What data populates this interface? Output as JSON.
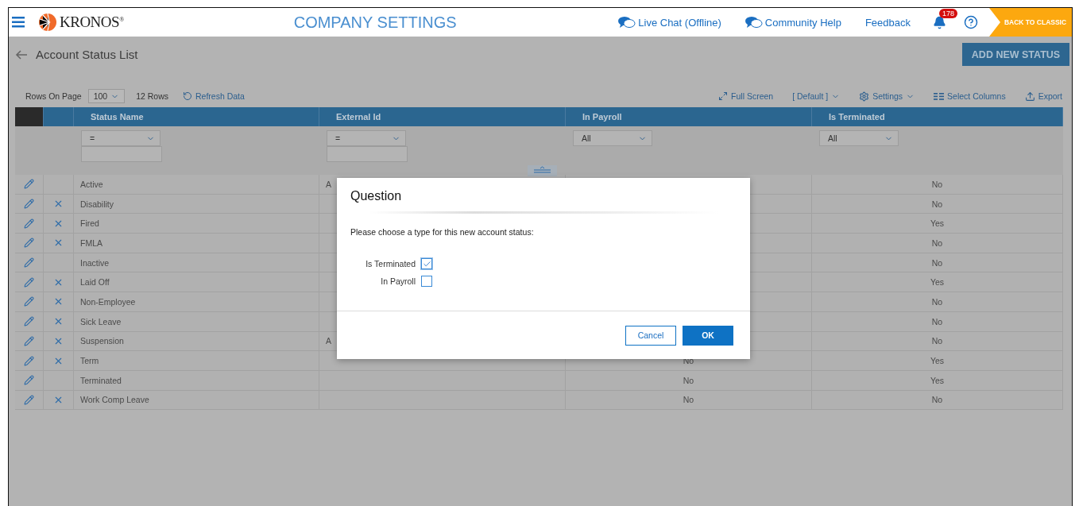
{
  "header": {
    "logo": "KRONOS$^{®}$",
    "title": "COMPANY SETTINGS",
    "links": [
      {
        "kind": "chat",
        "label": "Live Chat (Offline)"
      },
      {
        "kind": "chat",
        "label": "Community Help"
      },
      {
        "kind": "plain",
        "label": "Feedback"
      }
    ],
    "notifications": "178",
    "back_button": "BACK TO CLASSIC"
  },
  "page": {
    "title": "Account Status List",
    "add_button": "ADD NEW STATUS"
  },
  "toolbar": {
    "rows_label": "Rows On Page",
    "rows_value": "100",
    "row_count": "12 Rows",
    "refresh": "Refresh Data",
    "actions": [
      {
        "kind": "fullscreen",
        "label": "Full Screen"
      },
      {
        "kind": "view",
        "label": "[ Default ]"
      },
      {
        "kind": "settings",
        "label": "Settings"
      },
      {
        "kind": "columns",
        "label": "Select Columns"
      },
      {
        "kind": "export",
        "label": "Export"
      }
    ]
  },
  "table": {
    "columns": [
      "Status Name",
      "External Id",
      "In Payroll",
      "Is Terminated"
    ],
    "filters": [
      {
        "kind": "operator",
        "value": "="
      },
      {
        "kind": "operator",
        "value": "="
      },
      {
        "kind": "choice",
        "value": "All"
      },
      {
        "kind": "choice",
        "value": "All"
      }
    ],
    "rows": [
      {
        "deletable": false,
        "status_name": "Active",
        "external_id": "A",
        "is_terminated": "No"
      },
      {
        "deletable": true,
        "status_name": "Disability",
        "is_terminated": "No"
      },
      {
        "deletable": true,
        "status_name": "Fired",
        "is_terminated": "Yes"
      },
      {
        "deletable": true,
        "status_name": "FMLA",
        "is_terminated": "No"
      },
      {
        "deletable": false,
        "status_name": "Inactive",
        "is_terminated": "No"
      },
      {
        "deletable": true,
        "status_name": "Laid Off",
        "is_terminated": "Yes"
      },
      {
        "deletable": true,
        "status_name": "Non-Employee",
        "is_terminated": "No"
      },
      {
        "deletable": true,
        "status_name": "Sick Leave",
        "is_terminated": "No"
      },
      {
        "deletable": true,
        "status_name": "Suspension",
        "external_id": "A",
        "is_terminated": "No"
      },
      {
        "deletable": true,
        "status_name": "Term",
        "in_payroll": "No",
        "is_terminated": "Yes"
      },
      {
        "deletable": false,
        "status_name": "Terminated",
        "in_payroll": "No",
        "is_terminated": "Yes"
      },
      {
        "deletable": true,
        "status_name": "Work Comp Leave",
        "in_payroll": "No",
        "is_terminated": "No"
      }
    ]
  },
  "dialog": {
    "title": "Question",
    "message": "Please choose a type for this new account status:",
    "options": [
      {
        "label": "Is Terminated",
        "checked": true
      },
      {
        "label": "In Payroll",
        "checked": false
      }
    ],
    "buttons": [
      {
        "kind": "secondary",
        "label": "Cancel"
      },
      {
        "kind": "primary",
        "label": "OK"
      }
    ]
  }
}
